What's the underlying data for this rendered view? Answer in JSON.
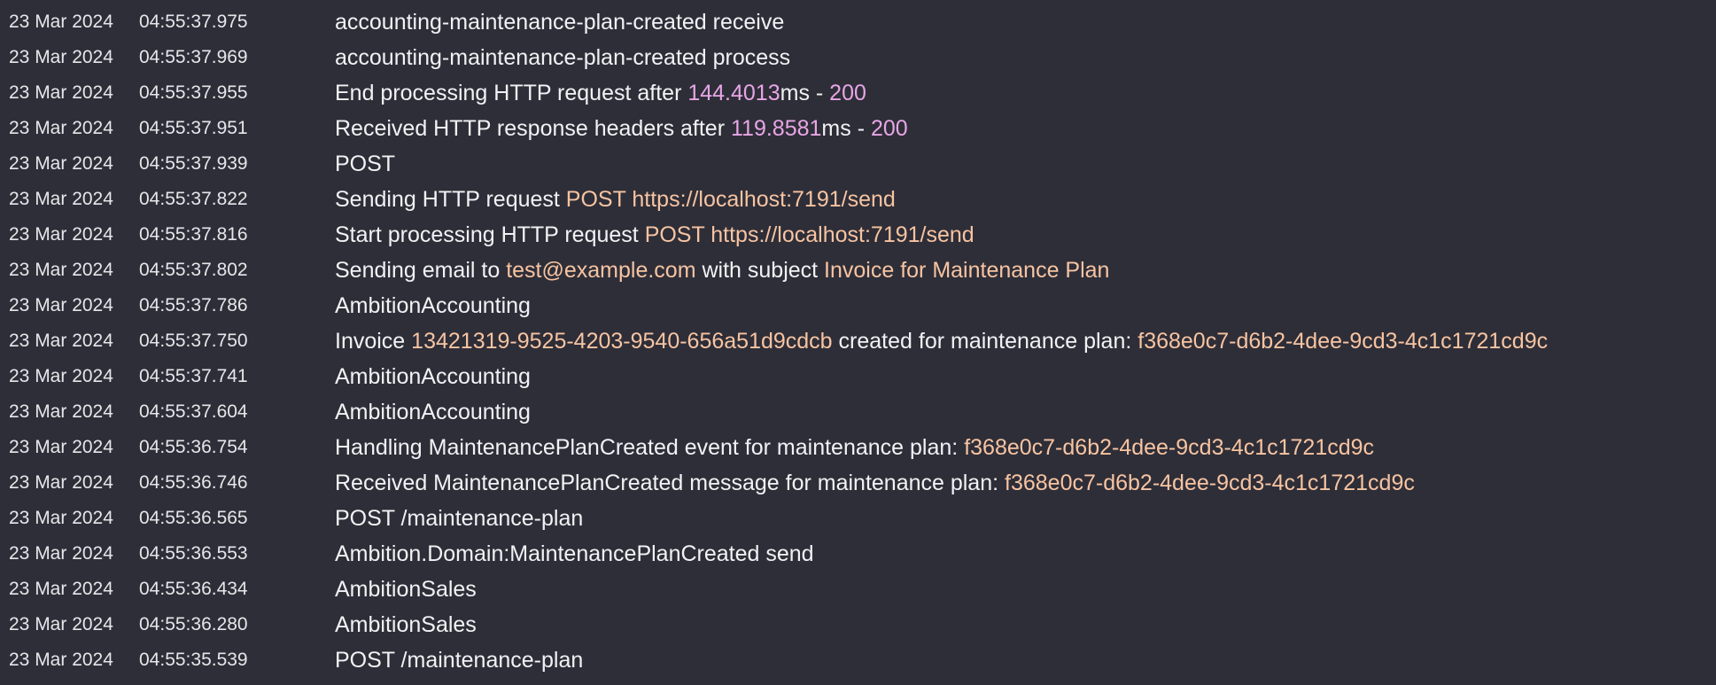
{
  "colors": {
    "background": "#2e2e38",
    "text": "#f2f2f5",
    "string_highlight": "#f7c4a2",
    "number_highlight": "#e8a6e6"
  },
  "log_entries": [
    {
      "date": "23 Mar 2024",
      "time": "04:55:37.975",
      "segments": [
        {
          "type": "text",
          "text": "accounting-maintenance-plan-created receive"
        }
      ]
    },
    {
      "date": "23 Mar 2024",
      "time": "04:55:37.969",
      "segments": [
        {
          "type": "text",
          "text": "accounting-maintenance-plan-created process"
        }
      ]
    },
    {
      "date": "23 Mar 2024",
      "time": "04:55:37.955",
      "segments": [
        {
          "type": "text",
          "text": "End processing HTTP request after "
        },
        {
          "type": "num",
          "text": "144.4013"
        },
        {
          "type": "text",
          "text": "ms - "
        },
        {
          "type": "num",
          "text": "200"
        }
      ]
    },
    {
      "date": "23 Mar 2024",
      "time": "04:55:37.951",
      "segments": [
        {
          "type": "text",
          "text": "Received HTTP response headers after "
        },
        {
          "type": "num",
          "text": "119.8581"
        },
        {
          "type": "text",
          "text": "ms - "
        },
        {
          "type": "num",
          "text": "200"
        }
      ]
    },
    {
      "date": "23 Mar 2024",
      "time": "04:55:37.939",
      "segments": [
        {
          "type": "text",
          "text": "POST"
        }
      ]
    },
    {
      "date": "23 Mar 2024",
      "time": "04:55:37.822",
      "segments": [
        {
          "type": "text",
          "text": "Sending HTTP request "
        },
        {
          "type": "str",
          "text": "POST"
        },
        {
          "type": "text",
          "text": " "
        },
        {
          "type": "str",
          "text": "https://localhost:7191/send"
        }
      ]
    },
    {
      "date": "23 Mar 2024",
      "time": "04:55:37.816",
      "segments": [
        {
          "type": "text",
          "text": "Start processing HTTP request "
        },
        {
          "type": "str",
          "text": "POST"
        },
        {
          "type": "text",
          "text": " "
        },
        {
          "type": "str",
          "text": "https://localhost:7191/send"
        }
      ]
    },
    {
      "date": "23 Mar 2024",
      "time": "04:55:37.802",
      "segments": [
        {
          "type": "text",
          "text": "Sending email to "
        },
        {
          "type": "str",
          "text": "test@example.com"
        },
        {
          "type": "text",
          "text": " with subject "
        },
        {
          "type": "str",
          "text": "Invoice for Maintenance Plan"
        }
      ]
    },
    {
      "date": "23 Mar 2024",
      "time": "04:55:37.786",
      "segments": [
        {
          "type": "text",
          "text": "AmbitionAccounting"
        }
      ]
    },
    {
      "date": "23 Mar 2024",
      "time": "04:55:37.750",
      "segments": [
        {
          "type": "text",
          "text": "Invoice "
        },
        {
          "type": "str",
          "text": "13421319-9525-4203-9540-656a51d9cdcb"
        },
        {
          "type": "text",
          "text": " created for maintenance plan: "
        },
        {
          "type": "str",
          "text": "f368e0c7-d6b2-4dee-9cd3-4c1c1721cd9c"
        }
      ]
    },
    {
      "date": "23 Mar 2024",
      "time": "04:55:37.741",
      "segments": [
        {
          "type": "text",
          "text": "AmbitionAccounting"
        }
      ]
    },
    {
      "date": "23 Mar 2024",
      "time": "04:55:37.604",
      "segments": [
        {
          "type": "text",
          "text": "AmbitionAccounting"
        }
      ]
    },
    {
      "date": "23 Mar 2024",
      "time": "04:55:36.754",
      "segments": [
        {
          "type": "text",
          "text": "Handling MaintenancePlanCreated event for maintenance plan: "
        },
        {
          "type": "str",
          "text": "f368e0c7-d6b2-4dee-9cd3-4c1c1721cd9c"
        }
      ]
    },
    {
      "date": "23 Mar 2024",
      "time": "04:55:36.746",
      "segments": [
        {
          "type": "text",
          "text": "Received MaintenancePlanCreated message for maintenance plan: "
        },
        {
          "type": "str",
          "text": "f368e0c7-d6b2-4dee-9cd3-4c1c1721cd9c"
        }
      ]
    },
    {
      "date": "23 Mar 2024",
      "time": "04:55:36.565",
      "segments": [
        {
          "type": "text",
          "text": "POST /maintenance-plan"
        }
      ]
    },
    {
      "date": "23 Mar 2024",
      "time": "04:55:36.553",
      "segments": [
        {
          "type": "text",
          "text": "Ambition.Domain:MaintenancePlanCreated send"
        }
      ]
    },
    {
      "date": "23 Mar 2024",
      "time": "04:55:36.434",
      "segments": [
        {
          "type": "text",
          "text": "AmbitionSales"
        }
      ]
    },
    {
      "date": "23 Mar 2024",
      "time": "04:55:36.280",
      "segments": [
        {
          "type": "text",
          "text": "AmbitionSales"
        }
      ]
    },
    {
      "date": "23 Mar 2024",
      "time": "04:55:35.539",
      "segments": [
        {
          "type": "text",
          "text": "POST /maintenance-plan"
        }
      ]
    }
  ]
}
